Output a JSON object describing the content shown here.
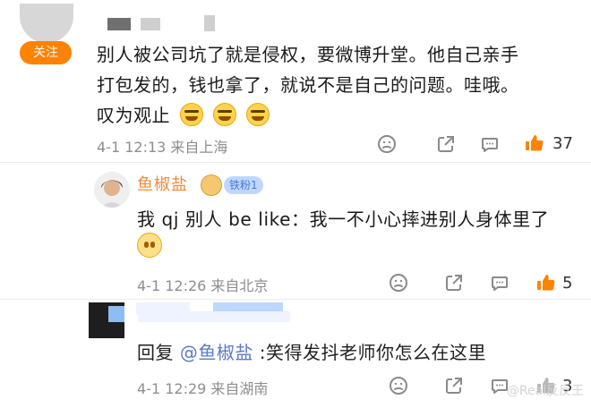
{
  "comments": [
    {
      "badge": "关注",
      "text_lines": [
        "别人被公司坑了就是侵权，要微博升堂。他自己亲手",
        "打包发的，钱也拿了，就说不是自己的问题。哇哦。",
        "叹为观止"
      ],
      "meta": "4-1 12:13 来自上海",
      "likes": "37"
    },
    {
      "username": "鱼椒盐",
      "fan_badge": "铁粉1",
      "text": "我 qj 别人 be like：我一不小心摔进别人身体里了",
      "meta": "4-1 12:26 来自北京",
      "likes": "5"
    },
    {
      "reply_prefix": "回复",
      "mention": "@鱼椒盐",
      "reply_text": ":笑得发抖老师你怎么在这里",
      "meta": "4-1 12:29 来自湖南",
      "likes": "3"
    }
  ],
  "watermark": "@Real反反王",
  "icons": {
    "dislike": "dislike-icon",
    "share": "share-icon",
    "comment": "comment-icon",
    "like": "thumb-up-icon"
  },
  "colors": {
    "follow_badge_bg": "#ff8200",
    "username": "#ef8b3b",
    "like_icon": "#ff8200",
    "mention": "#5b7bc3"
  }
}
